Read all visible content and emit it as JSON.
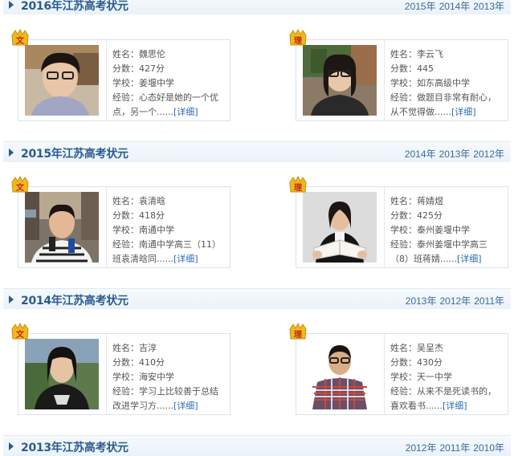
{
  "sections": [
    {
      "title": "2016年江苏高考状元",
      "years": [
        "2015年",
        "2014年",
        "2013年"
      ],
      "cards": [
        {
          "badge": "文",
          "name": "姓名：魏思伦",
          "score": "分数：427分",
          "school": "学校：姜堰中学",
          "exp1": "经验：心态好是她的一个优",
          "exp2": "点，另一个......",
          "more": "[详细]"
        },
        {
          "badge": "理",
          "name": "姓名：李云飞",
          "score": "分数：445",
          "school": "学校：如东高级中学",
          "exp1": "经验：做题目非常有耐心，",
          "exp2": "从不觉得做......",
          "more": "[详细]"
        }
      ]
    },
    {
      "title": "2015年江苏高考状元",
      "years": [
        "2014年",
        "2013年",
        "2012年"
      ],
      "cards": [
        {
          "badge": "文",
          "name": "姓名：袁清晗",
          "score": "分数：418分",
          "school": "学校：南通中学",
          "exp1": "经验：南通中学高三（11）",
          "exp2": "班袁清晗同......",
          "more": "[详细]"
        },
        {
          "badge": "理",
          "name": "姓名：蒋婧煜",
          "score": "分数：425分",
          "school": "学校：泰州姜堰中学",
          "exp1": "经验：泰州姜堰中学高三",
          "exp2": "（8）班蒋婧......",
          "more": "[详细]"
        }
      ]
    },
    {
      "title": "2014年江苏高考状元",
      "years": [
        "2013年",
        "2012年",
        "2011年"
      ],
      "cards": [
        {
          "badge": "文",
          "name": "姓名：吉淳",
          "score": "分数：410分",
          "school": "学校：海安中学",
          "exp1": "经验：学习上比较善于总结",
          "exp2": "改进学习方......",
          "more": "[详细]"
        },
        {
          "badge": "理",
          "name": "姓名：吴呈杰",
          "score": "分数：430分",
          "school": "学校：天一中学",
          "exp1": "经验：从来不是死读书的，",
          "exp2": "喜欢看书......",
          "more": "[详细]"
        }
      ]
    },
    {
      "title": "2013年江苏高考状元",
      "years": [
        "2012年",
        "2011年",
        "2010年"
      ],
      "cards": []
    }
  ],
  "colors": {
    "accent": "#2a5b8f",
    "link": "#2a6ab3",
    "badge": "#f2b81b",
    "badge_text": "#c0271d"
  }
}
